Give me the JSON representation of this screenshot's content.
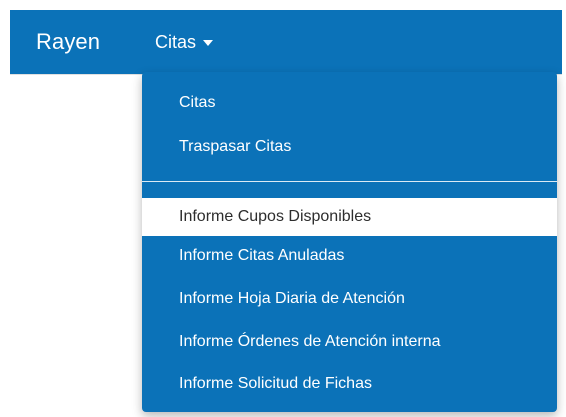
{
  "navbar": {
    "brand": "Rayen",
    "menu_label": "Citas",
    "menu_icon": "caret-down-icon"
  },
  "dropdown": {
    "group1": [
      {
        "label": "Citas"
      },
      {
        "label": "Traspasar Citas"
      }
    ],
    "group2": [
      {
        "label": "Informe Cupos Disponibles",
        "active": true
      },
      {
        "label": "Informe Citas Anuladas"
      },
      {
        "label": "Informe Hoja Diaria de Atención"
      },
      {
        "label": "Informe Órdenes de Atención interna"
      },
      {
        "label": "Informe Solicitud de Fichas"
      }
    ]
  },
  "colors": {
    "primary": "#0b72b8",
    "text_on_primary": "#ffffff",
    "active_item_bg": "#ffffff",
    "active_item_text": "#2d2d2d"
  }
}
